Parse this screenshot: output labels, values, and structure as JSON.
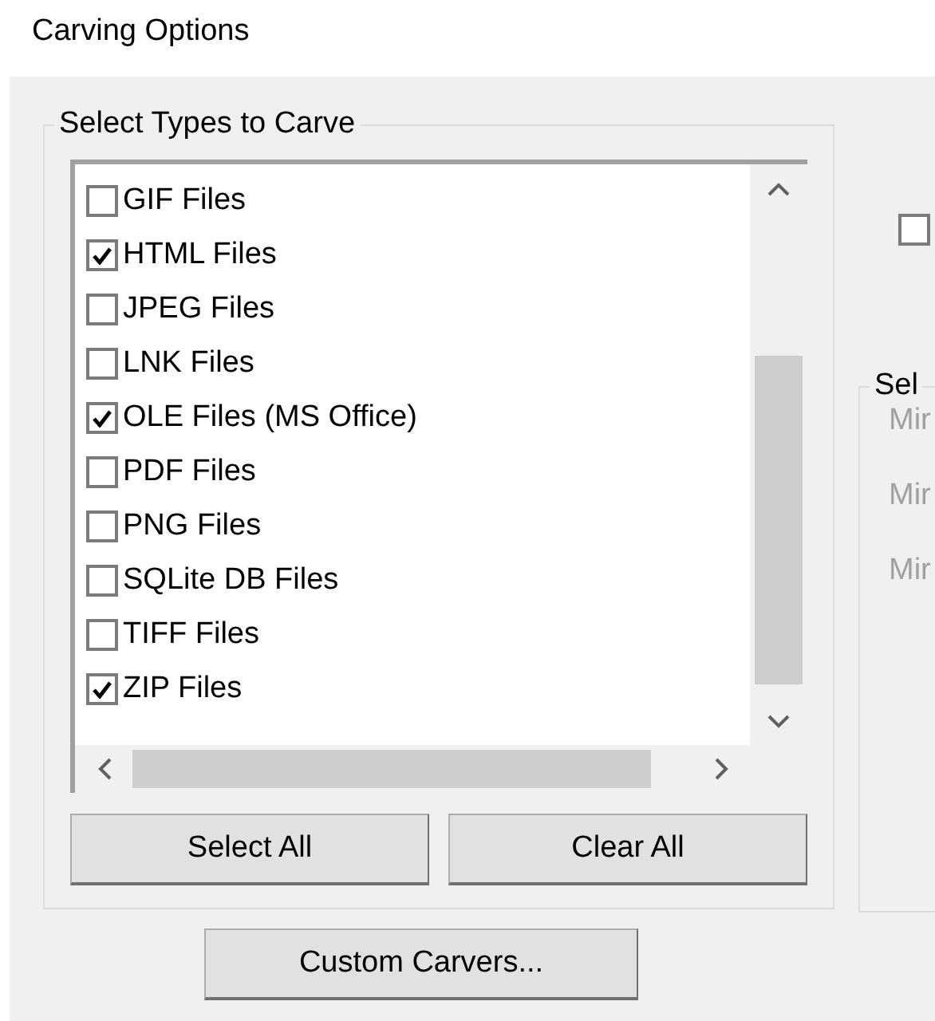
{
  "window": {
    "title": "Carving Options"
  },
  "types_group": {
    "label": "Select Types to Carve",
    "items": [
      {
        "label": "GIF Files",
        "checked": false
      },
      {
        "label": "HTML Files",
        "checked": true
      },
      {
        "label": "JPEG Files",
        "checked": false
      },
      {
        "label": "LNK Files",
        "checked": false
      },
      {
        "label": "OLE Files (MS Office)",
        "checked": true
      },
      {
        "label": "PDF Files",
        "checked": false
      },
      {
        "label": "PNG Files",
        "checked": false
      },
      {
        "label": "SQLite DB Files",
        "checked": false
      },
      {
        "label": "TIFF Files",
        "checked": false
      },
      {
        "label": "ZIP Files",
        "checked": true
      }
    ],
    "buttons": [
      "Select All",
      "Clear All"
    ]
  },
  "custom_button": "Custom Carvers...",
  "side_checkbox": {
    "checked": false
  },
  "side_group": {
    "label": "Sel",
    "fields": [
      {
        "label": "Mir",
        "disabled": true
      },
      {
        "label": "Mir",
        "disabled": true
      },
      {
        "label": "Mir",
        "disabled": true
      }
    ]
  }
}
